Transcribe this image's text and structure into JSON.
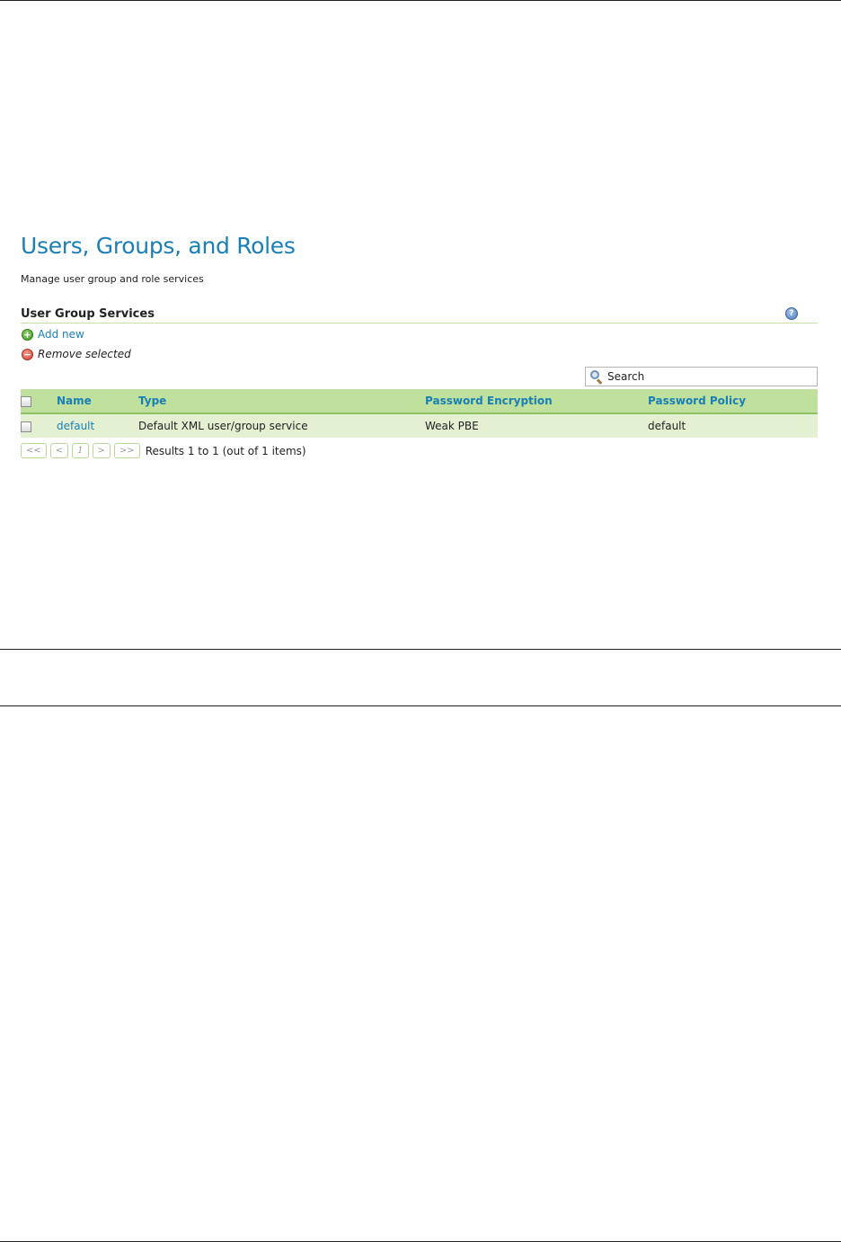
{
  "page": {
    "title": "Users, Groups, and Roles",
    "description": "Manage user group and role services"
  },
  "section": {
    "title": "User Group Services",
    "help_icon": "?"
  },
  "actions": {
    "add_new": "Add new",
    "remove_selected": "Remove selected"
  },
  "search": {
    "placeholder": "Search"
  },
  "table": {
    "headers": {
      "name": "Name",
      "type": "Type",
      "password_encryption": "Password Encryption",
      "password_policy": "Password Policy"
    },
    "rows": [
      {
        "name": "default",
        "type": "Default XML user/group service",
        "password_encryption": "Weak PBE",
        "password_policy": "default"
      }
    ]
  },
  "pager": {
    "first": "<<",
    "prev": "<",
    "page": "1",
    "next": ">",
    "last": ">>",
    "results": "Results 1 to 1 (out of 1 items)"
  },
  "colors": {
    "accent": "#1a7fb5",
    "header_bg": "#bfe19d",
    "row_bg": "#e3f1d2"
  }
}
